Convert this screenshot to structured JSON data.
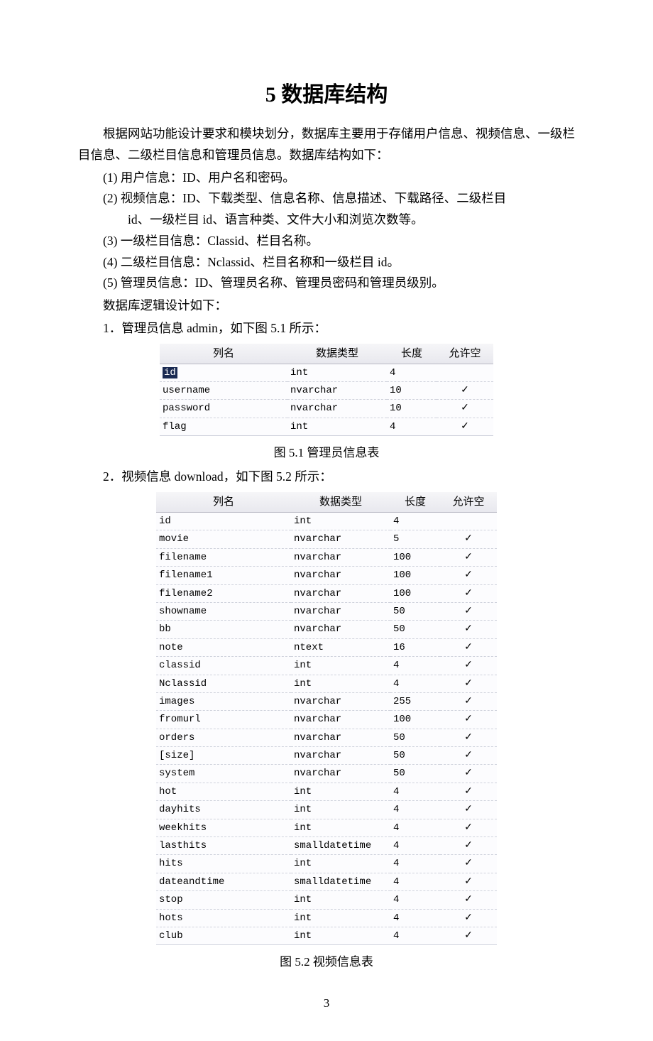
{
  "title": "5  数据库结构",
  "intro": "根据网站功能设计要求和模块划分，数据库主要用于存储用户信息、视频信息、一级栏目信息、二级栏目信息和管理员信息。数据库结构如下：",
  "bullets": [
    {
      "label": "(1)  用户信息：ID、用户名和密码。"
    },
    {
      "label": "(2)  视频信息：ID、下载类型、信息名称、信息描述、下载路径、二级栏目",
      "cont": "id、一级栏目 id、语言种类、文件大小和浏览次数等。"
    },
    {
      "label": "(3)  一级栏目信息：Classid、栏目名称。"
    },
    {
      "label": "(4)  二级栏目信息：Nclassid、栏目名称和一级栏目 id。"
    },
    {
      "label": "(5)  管理员信息：ID、管理员名称、管理员密码和管理员级别。"
    }
  ],
  "after_bullets": [
    "数据库逻辑设计如下：",
    "1．管理员信息 admin，如下图 5.1 所示："
  ],
  "table_headers": {
    "col_name": "列名",
    "data_type": "数据类型",
    "length": "长度",
    "allow_null": "允许空"
  },
  "table1": {
    "rows": [
      {
        "name": "id",
        "type": "int",
        "len": "4",
        "null": false,
        "highlight": true
      },
      {
        "name": "username",
        "type": "nvarchar",
        "len": "10",
        "null": true
      },
      {
        "name": "password",
        "type": "nvarchar",
        "len": "10",
        "null": true
      },
      {
        "name": "flag",
        "type": "int",
        "len": "4",
        "null": true
      }
    ],
    "caption": "图 5.1    管理员信息表"
  },
  "between": "2．视频信息 download，如下图 5.2 所示：",
  "table2": {
    "rows": [
      {
        "name": "id",
        "type": "int",
        "len": "4",
        "null": false
      },
      {
        "name": "movie",
        "type": "nvarchar",
        "len": "5",
        "null": true
      },
      {
        "name": "filename",
        "type": "nvarchar",
        "len": "100",
        "null": true
      },
      {
        "name": "filename1",
        "type": "nvarchar",
        "len": "100",
        "null": true
      },
      {
        "name": "filename2",
        "type": "nvarchar",
        "len": "100",
        "null": true
      },
      {
        "name": "showname",
        "type": "nvarchar",
        "len": "50",
        "null": true
      },
      {
        "name": "bb",
        "type": "nvarchar",
        "len": "50",
        "null": true
      },
      {
        "name": "note",
        "type": "ntext",
        "len": "16",
        "null": true
      },
      {
        "name": "classid",
        "type": "int",
        "len": "4",
        "null": true
      },
      {
        "name": "Nclassid",
        "type": "int",
        "len": "4",
        "null": true
      },
      {
        "name": "images",
        "type": "nvarchar",
        "len": "255",
        "null": true
      },
      {
        "name": "fromurl",
        "type": "nvarchar",
        "len": "100",
        "null": true
      },
      {
        "name": "orders",
        "type": "nvarchar",
        "len": "50",
        "null": true
      },
      {
        "name": "[size]",
        "type": "nvarchar",
        "len": "50",
        "null": true
      },
      {
        "name": "system",
        "type": "nvarchar",
        "len": "50",
        "null": true
      },
      {
        "name": "hot",
        "type": "int",
        "len": "4",
        "null": true
      },
      {
        "name": "dayhits",
        "type": "int",
        "len": "4",
        "null": true
      },
      {
        "name": "weekhits",
        "type": "int",
        "len": "4",
        "null": true
      },
      {
        "name": "lasthits",
        "type": "smalldatetime",
        "len": "4",
        "null": true
      },
      {
        "name": "hits",
        "type": "int",
        "len": "4",
        "null": true
      },
      {
        "name": "dateandtime",
        "type": "smalldatetime",
        "len": "4",
        "null": true
      },
      {
        "name": "stop",
        "type": "int",
        "len": "4",
        "null": true
      },
      {
        "name": "hots",
        "type": "int",
        "len": "4",
        "null": true
      },
      {
        "name": "club",
        "type": "int",
        "len": "4",
        "null": true
      }
    ],
    "caption": "图 5.2    视频信息表"
  },
  "page_number": "3",
  "check_glyph": "✓"
}
